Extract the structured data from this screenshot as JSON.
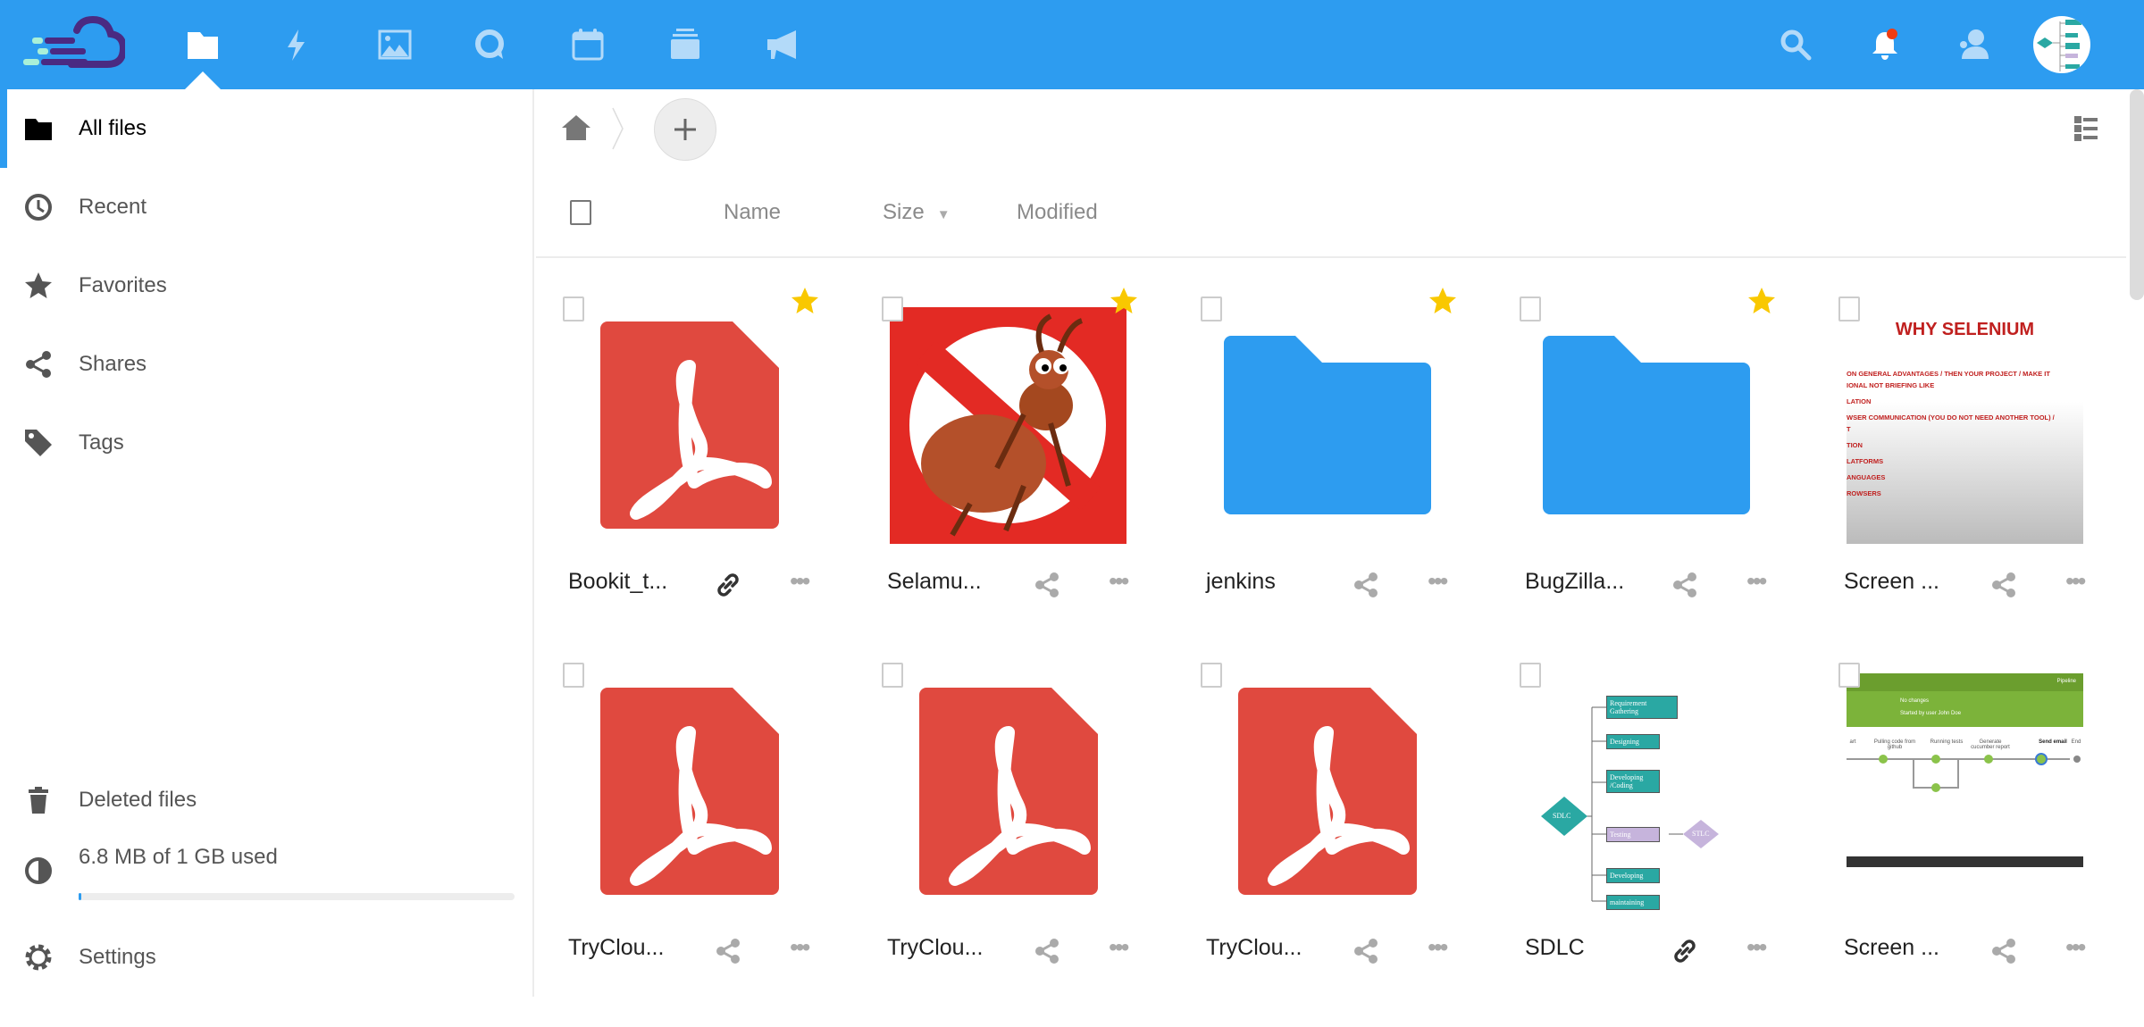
{
  "colors": {
    "primary": "#2d9cf0",
    "pdf": "#e0493f",
    "folder": "#2d9cf0",
    "star": "#f9c800"
  },
  "topbar": {
    "apps": [
      "files-icon",
      "activity-icon",
      "gallery-icon",
      "talk-icon",
      "calendar-icon",
      "deck-icon",
      "announcements-icon"
    ],
    "right": [
      "search-icon",
      "notifications-icon",
      "contacts-icon",
      "avatar"
    ]
  },
  "sidebar": {
    "items": [
      {
        "label": "All files",
        "icon": "folder-icon",
        "active": true
      },
      {
        "label": "Recent",
        "icon": "clock-icon"
      },
      {
        "label": "Favorites",
        "icon": "star-icon"
      },
      {
        "label": "Shares",
        "icon": "share-icon"
      },
      {
        "label": "Tags",
        "icon": "tag-icon"
      }
    ],
    "deleted": "Deleted files",
    "quota": "6.8 MB of 1 GB used",
    "quota_percent": 0.7,
    "settings": "Settings"
  },
  "list": {
    "headers": {
      "name": "Name",
      "size": "Size",
      "modified": "Modified"
    }
  },
  "files": [
    {
      "name": "Bookit_t...",
      "type": "pdf",
      "favorite": true,
      "share": "link"
    },
    {
      "name": "Selamu...",
      "type": "bug",
      "favorite": true,
      "share": "share"
    },
    {
      "name": "jenkins",
      "type": "folder",
      "favorite": true,
      "share": "share"
    },
    {
      "name": "BugZilla...",
      "type": "folder",
      "favorite": true,
      "share": "share"
    },
    {
      "name": "Screen ...",
      "type": "selenium",
      "favorite": false,
      "share": "share"
    },
    {
      "name": "TryClou...",
      "type": "pdf",
      "favorite": false,
      "share": "share"
    },
    {
      "name": "TryClou...",
      "type": "pdf",
      "favorite": false,
      "share": "share"
    },
    {
      "name": "TryClou...",
      "type": "pdf",
      "favorite": false,
      "share": "share"
    },
    {
      "name": "SDLC",
      "type": "sdlc",
      "favorite": false,
      "share": "link"
    },
    {
      "name": "Screen ...",
      "type": "pipeline",
      "favorite": false,
      "share": "share"
    }
  ],
  "thumbs": {
    "selenium": {
      "title": "WHY SELENIUM",
      "lines": [
        "ON GENERAL ADVANTAGES / THEN YOUR PROJECT / MAKE IT",
        "IONAL NOT BRIEFING LIKE",
        "LATION",
        "WSER COMMUNICATION (YOU DO NOT NEED ANOTHER TOOL) /",
        "T",
        "TION",
        "LATFORMS",
        "ANGUAGES",
        "ROWSERS"
      ]
    },
    "sdlc": {
      "center": "SDLC",
      "steps": [
        "Requirement Gathering",
        "Designing",
        "Developing /Coding",
        "Testing",
        "Developing",
        "maintaining"
      ],
      "side": "STLC"
    },
    "pipeline": {
      "tag": "Pipeline",
      "l1": "No changes",
      "l2": "Started by user John Doe",
      "stages": [
        "art",
        "Pulling code from github",
        "Running tests",
        "Generate cucumber report",
        "Send email",
        "End"
      ]
    }
  }
}
